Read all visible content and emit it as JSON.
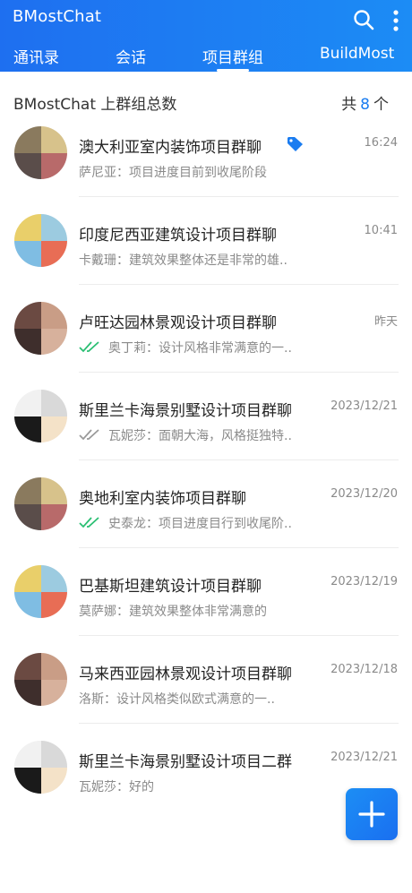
{
  "header": {
    "title": "BMostChat",
    "icons": {
      "search": "search-icon",
      "more": "more-vertical-icon"
    },
    "colors": {
      "bar": "#1e6ff0",
      "text": "#ffffff"
    }
  },
  "tabs": [
    {
      "label": "通讯录"
    },
    {
      "label": "会话"
    },
    {
      "label": "项目群组",
      "active": true
    },
    {
      "label": "BuildMost"
    }
  ],
  "summary": {
    "label": "BMostChat 上群组总数",
    "prefix": "共",
    "count": "8",
    "suffix": "个",
    "count_color": "#1a7cf0"
  },
  "groups": [
    {
      "name": "澳大利亚室内装饰项目群聊",
      "time": "16:24",
      "message": "萨尼亚：项目进度目前到收尾阶段",
      "tagged": true,
      "check": "none",
      "avatar": "photo-collage"
    },
    {
      "name": "印度尼西亚建筑设计项目群聊",
      "time": "10:41",
      "message": "卡戴珊：建筑效果整体还是非常的雄..",
      "check": "none",
      "avatar": "sticker-collage"
    },
    {
      "name": "卢旺达园林景观设计项目群聊",
      "time": "昨天",
      "message": "奥丁莉：设计风格非常满意的一..",
      "check": "read",
      "avatar": "portrait-collage"
    },
    {
      "name": "斯里兰卡海景别墅设计项目群聊",
      "time": "2023/12/21",
      "message": "瓦妮莎：面朝大海，风格挺独特..",
      "check": "sent",
      "avatar": "cartoon-collage"
    },
    {
      "name": "奥地利室内装饰项目群聊",
      "time": "2023/12/20",
      "message": "史泰龙：项目进度目行到收尾阶..",
      "check": "read",
      "avatar": "photo-collage"
    },
    {
      "name": "巴基斯坦建筑设计项目群聊",
      "time": "2023/12/19",
      "message": "莫萨娜：建筑效果整体非常满意的",
      "check": "none",
      "avatar": "sticker-collage"
    },
    {
      "name": "马来西亚园林景观设计项目群聊",
      "time": "2023/12/18",
      "message": "洛斯：设计风格类似欧式满意的一..",
      "check": "none",
      "avatar": "portrait-collage"
    },
    {
      "name": "斯里兰卡海景别墅设计项目二群",
      "time": "2023/12/21",
      "message": "瓦妮莎：好的",
      "check": "none",
      "avatar": "cartoon-collage"
    }
  ],
  "fab": {
    "icon": "plus-icon",
    "color": "#1a7cf0"
  },
  "colors": {
    "check_read": "#2bbf73",
    "check_sent": "#9a9a9a",
    "tag": "#1a7cf0"
  }
}
